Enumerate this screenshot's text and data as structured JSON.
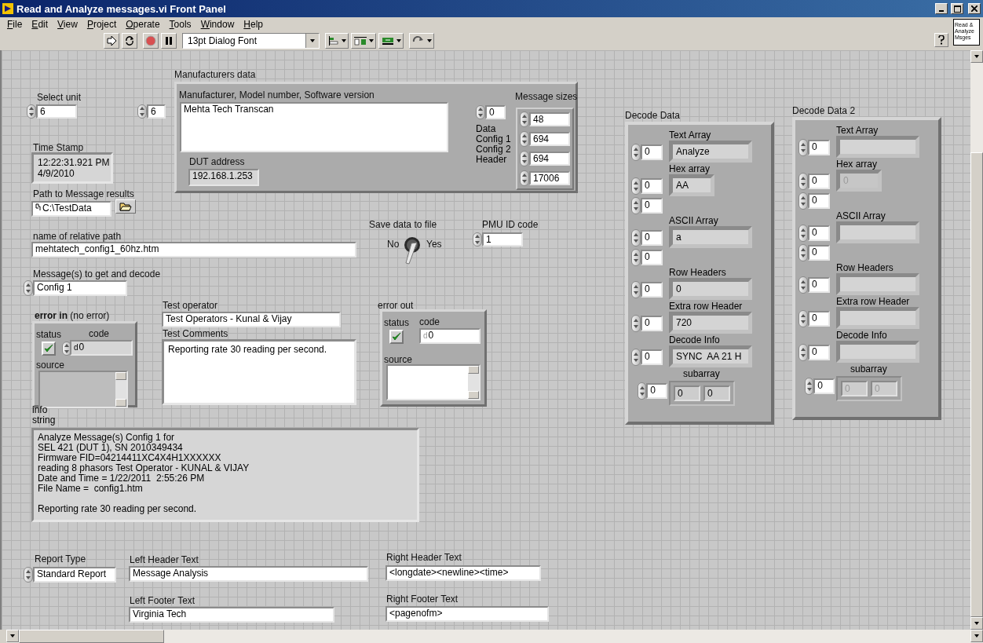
{
  "window": {
    "title": "Read and Analyze messages.vi Front Panel"
  },
  "menu": [
    "File",
    "Edit",
    "View",
    "Project",
    "Operate",
    "Tools",
    "Window",
    "Help"
  ],
  "toolbar": {
    "font": "13pt Dialog Font"
  },
  "vi_icon": [
    "Read &",
    "Analyze",
    "Msges"
  ],
  "select_unit": {
    "label": "Select unit",
    "value": "6"
  },
  "manufacturers_data": {
    "label": "Manufacturers data",
    "index": "6",
    "string_label": "Manufacturer, Model number, Software version",
    "string_value": "Mehta Tech Transcan",
    "dut_label": "DUT address",
    "dut_value": "192.168.1.253",
    "sizes_label": "Message sizes",
    "sizes_index": "0",
    "size_names": [
      "Data",
      "Config 1",
      "Config 2",
      "Header"
    ],
    "sizes": [
      "48",
      "694",
      "694",
      "17006"
    ]
  },
  "time_stamp": {
    "label": "Time Stamp",
    "value": "12:22:31.921 PM\n4/9/2010"
  },
  "path": {
    "label": "Path to Message results",
    "value": "C:\\TestData"
  },
  "relative_path": {
    "label": "name of relative path",
    "value": "mehtatech_config1_60hz.htm"
  },
  "save_switch": {
    "label": "Save data to file",
    "off_label": "No",
    "on_label": "Yes",
    "on": true
  },
  "pmu_id": {
    "label": "PMU ID code",
    "value": "1"
  },
  "messages": {
    "label": "Message(s) to get and decode",
    "value": "Config 1"
  },
  "error_in": {
    "label": "**error in** (no error)",
    "status_label": "status",
    "code_label": "code",
    "status_ok": true,
    "radix": "d",
    "code": "0",
    "source_label": "source"
  },
  "test_operator": {
    "label": "Test operator",
    "value": "Test Operators - Kunal & Vijay"
  },
  "test_comments": {
    "label": "Test Comments",
    "value": "Reporting rate 30 reading per second."
  },
  "error_out": {
    "label": "error out",
    "status_label": "status",
    "code_label": "code",
    "status_ok": true,
    "radix": "d",
    "code": "0",
    "source_label": "source"
  },
  "info_string": {
    "label": "info string",
    "value": "Analyze Message(s) Config 1 for\nSEL 421 (DUT 1), SN 2010349434\nFirmware FID=04214411XC4X4H1XXXXXX\nreading 8 phasors Test Operator - KUNAL & VIJAY\nDate and Time = 1/22/2011  2:55:26 PM\nFile Name =  config1.htm\n\nReporting rate 30 reading per second."
  },
  "report": {
    "type_label": "Report Type",
    "type_value": "Standard Report",
    "left_header_label": "Left Header Text",
    "left_header": "Message Analysis",
    "left_footer_label": "Left Footer Text",
    "left_footer": "Virginia Tech",
    "right_header_label": "Right Header Text",
    "right_header": "<longdate><newline><time>",
    "right_footer_label": "Right Footer Text",
    "right_footer": "<pagenofm>"
  },
  "decode": [
    {
      "title": "Decode Data",
      "items": [
        {
          "kind": "string",
          "label": "Text Array",
          "indices": [
            "0"
          ],
          "values": [
            "Analyze"
          ],
          "dimmed": false
        },
        {
          "kind": "hex",
          "label": "Hex array",
          "indices": [
            "0",
            "0"
          ],
          "values": [
            "AA"
          ],
          "dimmed": false
        },
        {
          "kind": "string",
          "label": "ASCII Array",
          "indices": [
            "0",
            "0"
          ],
          "values": [
            "a"
          ],
          "dimmed": false
        },
        {
          "kind": "string",
          "label": "Row Headers",
          "indices": [
            "0"
          ],
          "values": [
            "0"
          ],
          "dimmed": false
        },
        {
          "kind": "string",
          "label": "Extra row Header",
          "indices": [
            "0"
          ],
          "values": [
            "720"
          ],
          "dimmed": false
        },
        {
          "kind": "string",
          "label": "Decode Info",
          "indices": [
            "0"
          ],
          "values": [
            "SYNC  AA 21 H"
          ],
          "dimmed": false
        },
        {
          "kind": "subarray",
          "label": "subarray",
          "indices": [
            "0"
          ],
          "values": [
            "0",
            "0"
          ],
          "dimmed": false
        }
      ]
    },
    {
      "title": "Decode Data 2",
      "items": [
        {
          "kind": "string",
          "label": "Text Array",
          "indices": [
            "0"
          ],
          "dimmed": false
        },
        {
          "kind": "hex",
          "label": "Hex array",
          "indices": [
            "0",
            "0"
          ],
          "values": [
            "0"
          ],
          "dimmed": true
        },
        {
          "kind": "string",
          "label": "ASCII Array",
          "indices": [
            "0",
            "0"
          ],
          "dimmed": false
        },
        {
          "kind": "string",
          "label": "Row Headers",
          "indices": [
            "0"
          ],
          "dimmed": false
        },
        {
          "kind": "string",
          "label": "Extra row Header",
          "indices": [
            "0"
          ],
          "dimmed": false
        },
        {
          "kind": "string",
          "label": "Decode Info",
          "indices": [
            "0"
          ],
          "dimmed": false
        },
        {
          "kind": "subarray",
          "label": "subarray",
          "indices": [
            "0"
          ],
          "values": [
            "0",
            "0"
          ],
          "dimmed": true
        }
      ]
    }
  ]
}
